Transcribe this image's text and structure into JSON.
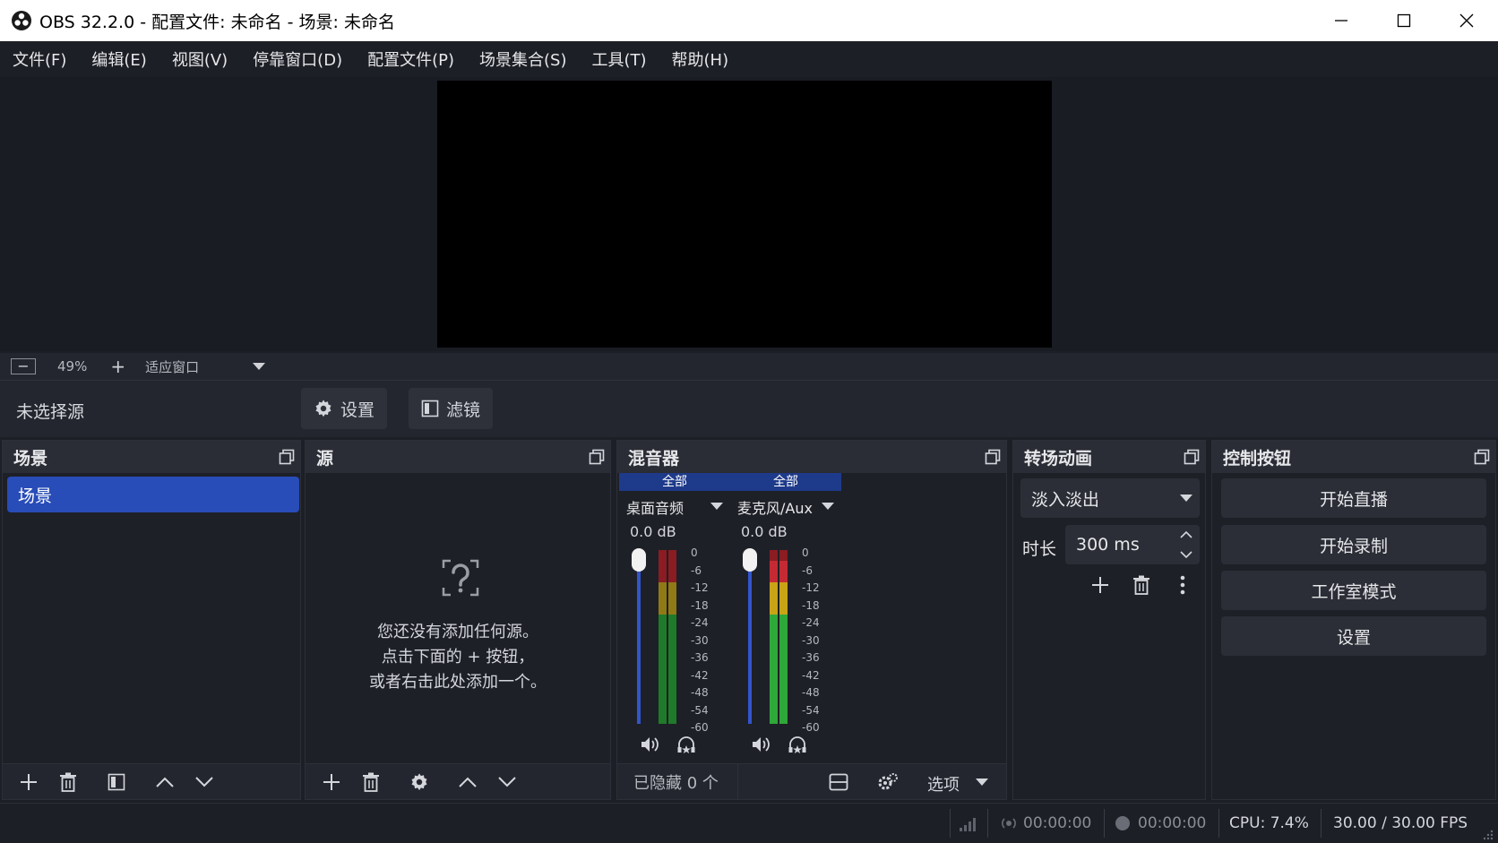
{
  "window": {
    "title": "OBS 32.2.0 - 配置文件: 未命名 - 场景: 未命名"
  },
  "menu": [
    "文件(F)",
    "编辑(E)",
    "视图(V)",
    "停靠窗口(D)",
    "配置文件(P)",
    "场景集合(S)",
    "工具(T)",
    "帮助(H)"
  ],
  "zoom": {
    "minus": "−",
    "percent": "49%",
    "plus": "+",
    "fit_label": "适应窗口"
  },
  "sourcebar": {
    "no_source": "未选择源",
    "settings_label": "设置",
    "filters_label": "滤镜"
  },
  "scenes": {
    "title": "场景",
    "items": [
      "场景"
    ]
  },
  "sources": {
    "title": "源",
    "empty_line1": "您还没有添加任何源。",
    "empty_line2": "点击下面的 + 按钮，",
    "empty_line3": "或者右击此处添加一个。"
  },
  "mixer": {
    "title": "混音器",
    "channels": [
      {
        "tag": "全部",
        "name": "桌面音频",
        "db": "0.0 dB"
      },
      {
        "tag": "全部",
        "name": "麦克风/Aux",
        "db": "0.0 dB"
      }
    ],
    "scale": [
      "0",
      "-6",
      "-12",
      "-18",
      "-24",
      "-30",
      "-36",
      "-42",
      "-48",
      "-54",
      "-60"
    ],
    "hidden_label": "已隐藏 0 个",
    "options_label": "选项"
  },
  "transitions": {
    "title": "转场动画",
    "selected": "淡入淡出",
    "duration_label": "时长",
    "duration_value": "300 ms"
  },
  "controls": {
    "title": "控制按钮",
    "buttons": [
      "开始直播",
      "开始录制",
      "工作室模式",
      "设置"
    ]
  },
  "status": {
    "stream_time": "00:00:00",
    "record_time": "00:00:00",
    "cpu": "CPU: 7.4%",
    "fps": "30.00 / 30.00 FPS"
  },
  "colors": {
    "accent": "#284cb8",
    "meter_green": "#2fa83a",
    "meter_yellow": "#c9a316",
    "meter_red": "#b0212a"
  }
}
